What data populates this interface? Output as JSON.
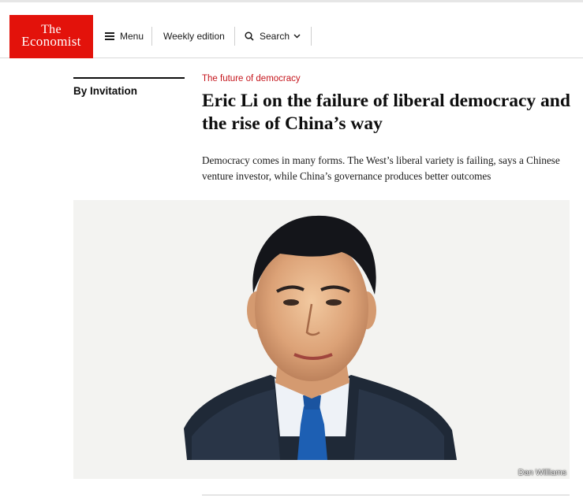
{
  "brand": {
    "line1": "The",
    "line2": "Economist",
    "color": "#e3120b"
  },
  "nav": {
    "menu_label": "Menu",
    "weekly_label": "Weekly edition",
    "search_label": "Search"
  },
  "article": {
    "section": "By Invitation",
    "rubric": "The future of democracy",
    "headline": "Eric Li on the failure of liberal democracy and the rise of China’s way",
    "standfirst": "Democracy comes in many forms. The West’s liberal variety is failing, says a Chinese venture investor, while China’s governance produces better outcomes",
    "image_credit": "Dan Williams"
  },
  "icons": {
    "menu": "hamburger-icon",
    "search": "magnifier-icon",
    "chevron": "chevron-down-icon"
  },
  "colors": {
    "accent_red": "#c5161d",
    "logo_red": "#e3120b"
  }
}
